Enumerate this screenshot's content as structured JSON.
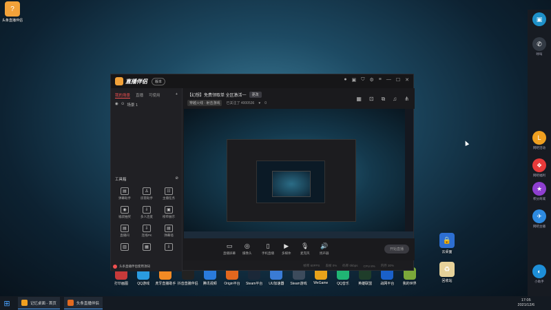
{
  "desktop": {
    "top_left_icon": {
      "label": "头条直播伴侣",
      "color": "#f2a23a"
    },
    "right_icons": [
      {
        "label": "云桌面",
        "color": "#2d6fd2"
      },
      {
        "label": "回收站",
        "color": "#e6d29a"
      }
    ],
    "bottom_icons": [
      {
        "label": "打印画图",
        "color": "#c63a3a"
      },
      {
        "label": "QQ游戏",
        "color": "#2a9be0"
      },
      {
        "label": "虎牙直播助手",
        "color": "#f28a24"
      },
      {
        "label": "抖音直播伴侣",
        "color": "#222222"
      },
      {
        "label": "腾讯视频",
        "color": "#2a7bdc"
      },
      {
        "label": "Origin平台",
        "color": "#e2671e"
      },
      {
        "label": "Steam平台",
        "color": "#1b2838"
      },
      {
        "label": "UU加速器",
        "color": "#3a7bd5"
      },
      {
        "label": "Steam游戏",
        "color": "#3c4b5c"
      },
      {
        "label": "WeGame",
        "color": "#e7a31b"
      },
      {
        "label": "QQ音乐",
        "color": "#20b574"
      },
      {
        "label": "英雄联盟",
        "color": "#1f3d2a"
      },
      {
        "label": "战网平台",
        "color": "#1a60c9"
      },
      {
        "label": "我的世界",
        "color": "#7ba83a"
      }
    ]
  },
  "right_sidebar": {
    "items": [
      {
        "label": "",
        "icon": "monitor-icon",
        "color": "#1e90c8"
      },
      {
        "label": "呼叫",
        "icon": "phone-icon",
        "color": "#333a44"
      },
      {
        "label": "网吧活动",
        "icon": "coin-icon",
        "color": "#f0a020"
      },
      {
        "label": "网吧福利",
        "icon": "gift-icon",
        "color": "#e83a3a"
      },
      {
        "label": "积分商城",
        "icon": "star-icon",
        "color": "#8e3fd0"
      },
      {
        "label": "网吧主播",
        "icon": "bird-icon",
        "color": "#2d8ae0"
      },
      {
        "label": "小助手",
        "icon": "assistant-icon",
        "color": "#1e8fd8"
      }
    ]
  },
  "window": {
    "brand": "直播伴侣",
    "version": "版本",
    "tabs": [
      "我的场景",
      "直播",
      "可使用"
    ],
    "scene_item": "场景 1",
    "tools_title": "工具箱",
    "tools": [
      {
        "label": "弹幕助手",
        "icon": "▤"
      },
      {
        "label": "房管助手",
        "icon": "♙"
      },
      {
        "label": "主播任务",
        "icon": "☷"
      },
      {
        "label": "福袋抽奖",
        "icon": "◉"
      },
      {
        "label": "多人连麦",
        "icon": "⇩"
      },
      {
        "label": "榜单展示",
        "icon": "▣"
      },
      {
        "label": "直播间",
        "icon": "▤"
      },
      {
        "label": "连线PK",
        "icon": "⇩"
      },
      {
        "label": "弹幕墙",
        "icon": "▤"
      },
      {
        "label": "",
        "icon": "▥"
      },
      {
        "label": "",
        "icon": "▦"
      },
      {
        "label": "",
        "icon": "⇩"
      }
    ],
    "notice": "头条直播伴侣使用须知",
    "info": {
      "title": "【幻想】免费领取单 全区激活一",
      "tag": "更改",
      "category": "穿越火线 · 射击游戏",
      "followers": "已关注了 4000536",
      "likes": "0"
    },
    "controls": [
      {
        "label": "直播屏幕",
        "icon": "▭"
      },
      {
        "label": "摄像头",
        "icon": "◎"
      },
      {
        "label": "手机直播",
        "icon": "▯"
      },
      {
        "label": "多媒体",
        "icon": "▶"
      },
      {
        "label": "麦克风",
        "icon": "🎙"
      },
      {
        "label": "扬声器",
        "icon": "🔊"
      }
    ],
    "start_button": "开始直播",
    "status": [
      "帧率 60FPS",
      "丢帧 0%",
      "码率 0kbps",
      "CPU 8%",
      "内存 30%"
    ]
  },
  "taskbar": {
    "apps": [
      {
        "label": "记忆桌面 - 首页",
        "color": "#f0a020"
      },
      {
        "label": "头条直播伴侣",
        "color": "#e26a20"
      }
    ],
    "time": "17:05",
    "date": "2021/12/6"
  }
}
